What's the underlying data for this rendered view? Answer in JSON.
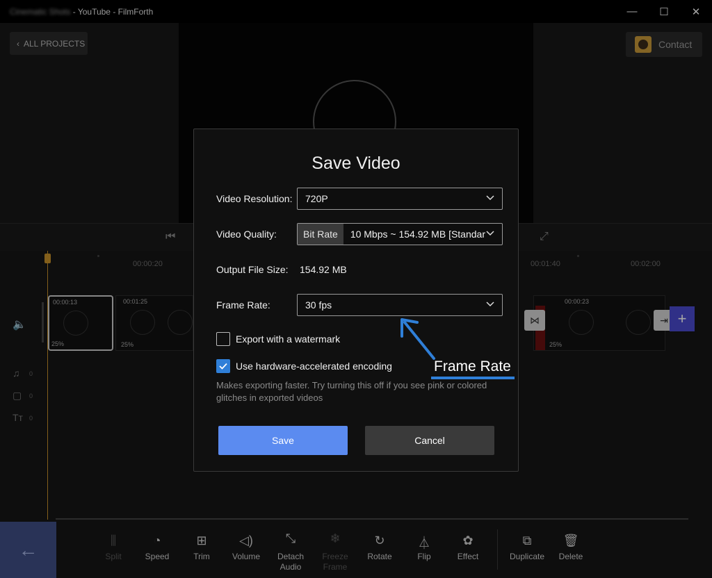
{
  "window": {
    "title_blurred": "Cinematic Shots",
    "title_suffix": " - YouTube - FilmForth",
    "minimize": "—",
    "maximize": "☐",
    "close": "✕"
  },
  "nav": {
    "all_projects": "ALL PROJECTS",
    "contact": "Contact"
  },
  "timeline": {
    "ruler": [
      "00:00:20",
      "00:01:40",
      "00:02:00"
    ],
    "clips": [
      {
        "duration": "00:00:13",
        "volume": "25%"
      },
      {
        "duration": "00:01:25",
        "volume": "25%"
      },
      {
        "duration": "00:00:23",
        "volume": "25%"
      }
    ],
    "track_counts": [
      "0",
      "0",
      "0"
    ]
  },
  "toolbar": {
    "items": [
      {
        "label": "Split",
        "icon": "split-icon",
        "enabled": false
      },
      {
        "label": "Speed",
        "icon": "speed-icon",
        "enabled": true
      },
      {
        "label": "Trim",
        "icon": "trim-icon",
        "enabled": true
      },
      {
        "label": "Volume",
        "icon": "volume-icon",
        "enabled": true
      },
      {
        "label": "Detach Audio",
        "icon": "detach-audio-icon",
        "enabled": true
      },
      {
        "label": "Freeze Frame",
        "icon": "freeze-icon",
        "enabled": false
      },
      {
        "label": "Rotate",
        "icon": "rotate-icon",
        "enabled": true
      },
      {
        "label": "Flip",
        "icon": "flip-icon",
        "enabled": true
      },
      {
        "label": "Effect",
        "icon": "effect-icon",
        "enabled": true
      },
      {
        "label": "Duplicate",
        "icon": "duplicate-icon",
        "enabled": true
      },
      {
        "label": "Delete",
        "icon": "delete-icon",
        "enabled": true
      }
    ]
  },
  "dialog": {
    "title": "Save Video",
    "resolution_label": "Video Resolution:",
    "resolution_value": "720P",
    "quality_label": "Video Quality:",
    "quality_mode": "Bit Rate",
    "quality_value": "10 Mbps ~ 154.92 MB [Standar",
    "filesize_label": "Output File Size:",
    "filesize_value": "154.92 MB",
    "framerate_label": "Frame Rate:",
    "framerate_value": "30 fps",
    "watermark_label": "Export with a watermark",
    "watermark_checked": false,
    "hwaccel_label": "Use hardware-accelerated encoding",
    "hwaccel_checked": true,
    "hint": "Makes exporting faster. Try turning this off if you see pink or colored glitches in exported videos",
    "save": "Save",
    "cancel": "Cancel"
  },
  "annotation": {
    "text": "Frame Rate",
    "color": "#2f7fd8"
  },
  "colors": {
    "accent": "#5b8bf0",
    "playhead": "#c9922a",
    "checkbox": "#2f7fd8"
  }
}
